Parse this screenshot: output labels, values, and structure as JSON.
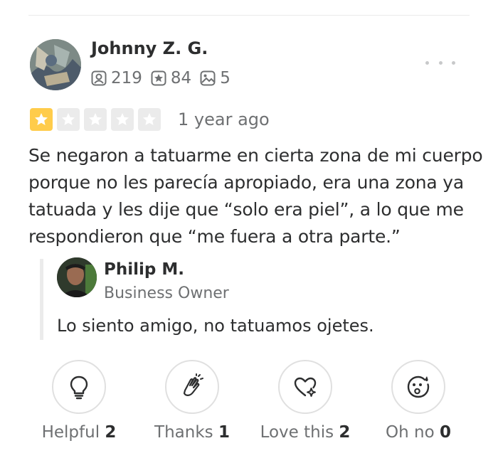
{
  "review": {
    "user": {
      "name": "Johnny Z. G.",
      "friends_count": "219",
      "reviews_count": "84",
      "photos_count": "5",
      "avatar_icon": "user-avatar-photo"
    },
    "rating": {
      "value": 1,
      "max": 5,
      "filled_color": "#ffcc4b",
      "empty_color": "#ebebeb"
    },
    "date": "1 year ago",
    "text": "Se negaron a tatuarme en cierta zona de mi cuerpo porque no les parecía apropiado, era una zona ya tatuada y les dije que “solo era piel”, a lo que me respondieron que “me fuera a otra parte.”"
  },
  "reply": {
    "name": "Philip M.",
    "role": "Business Owner",
    "text": "Lo siento amigo, no tatuamos ojetes."
  },
  "reactions": [
    {
      "icon": "lightbulb-icon",
      "label": "Helpful",
      "count": "2"
    },
    {
      "icon": "clapping-hands-icon",
      "label": "Thanks",
      "count": "1"
    },
    {
      "icon": "heart-sparkle-icon",
      "label": "Love this",
      "count": "2"
    },
    {
      "icon": "surprised-face-icon",
      "label": "Oh no",
      "count": "0"
    }
  ]
}
